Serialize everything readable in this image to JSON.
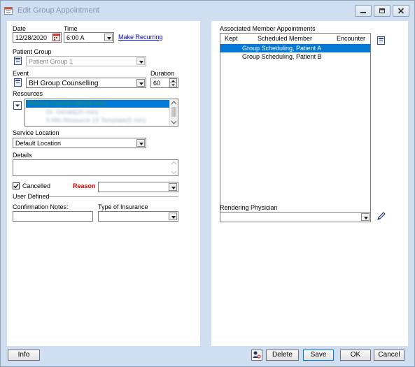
{
  "window": {
    "title": "Edit Group Appointment"
  },
  "left": {
    "date_label": "Date",
    "date_value": "12/28/2020",
    "time_label": "Time",
    "time_value": "6:00 A",
    "make_recurring": "Make Recurring",
    "patient_group_label": "Patient Group",
    "patient_group_value": "Patient Group 1",
    "event_label": "Event",
    "event_value": "BH Group Counselling",
    "duration_label": "Duration",
    "duration_value": "60",
    "resources_label": "Resources",
    "resources": [
      "Patricia Charles NP(20 min)",
      "Dr. Gerald(20 min)",
      "5 Min Resource 15 Template(5 min)"
    ],
    "service_location_label": "Service Location",
    "service_location_value": "Default Location",
    "details_label": "Details",
    "details_value": "",
    "cancelled_label": "Cancelled",
    "cancelled_checked": true,
    "reason_label": "Reason",
    "reason_value": "",
    "user_defined_label": "User Defined",
    "confirmation_notes_label": "Confirmation Notes:",
    "confirmation_notes_value": "",
    "insurance_label": "Type of Insurance",
    "insurance_value": ""
  },
  "right": {
    "assoc_label": "Associated Member Appointments",
    "columns": [
      "Kept",
      "Scheduled Member",
      "Encounter"
    ],
    "rows": [
      {
        "kept": "",
        "member": "Group Scheduling, Patient A",
        "encounter": "",
        "selected": true
      },
      {
        "kept": "",
        "member": "Group Scheduling, Patient B",
        "encounter": "",
        "selected": false
      }
    ],
    "rendering_label": "Rendering Physician",
    "rendering_value": ""
  },
  "buttons": {
    "info": "Info",
    "delete": "Delete",
    "save": "Save",
    "ok": "OK",
    "cancel": "Cancel"
  },
  "colors": {
    "selection": "#0078d7",
    "link": "#0000ee",
    "reason": "#e00000",
    "frame": "#cfdff1"
  }
}
